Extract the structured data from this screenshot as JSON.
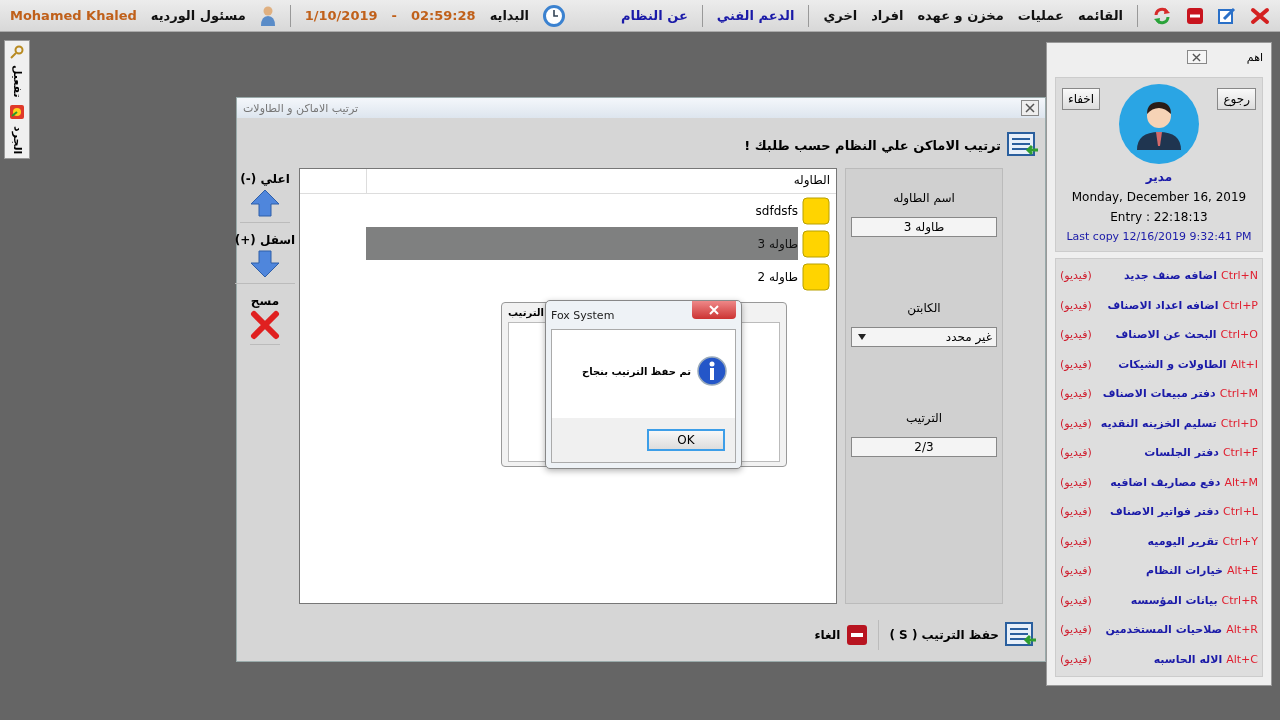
{
  "top_bar": {
    "actions": [
      {
        "kind": "close"
      },
      {
        "kind": "edit"
      },
      {
        "kind": "minimize"
      },
      {
        "kind": "refresh"
      }
    ],
    "menu": [
      {
        "label": "القائمه",
        "kind": "menu"
      },
      {
        "label": "عمليات",
        "kind": "menu"
      },
      {
        "label": "مخزن و عهده",
        "kind": "menu"
      },
      {
        "label": "افراد",
        "kind": "menu"
      },
      {
        "label": "اخري",
        "kind": "menu"
      },
      {
        "label": "الدعم الفني",
        "kind": "link"
      },
      {
        "label": "عن النظام",
        "kind": "link"
      }
    ],
    "start_label": "البدايه",
    "time": "02:59:28",
    "separator": "-",
    "date": "1/10/2019",
    "role": "مسئول الورديه",
    "user_name": "Mohamed Khaled"
  },
  "side_strip": [
    {
      "label": "تفعيل"
    },
    {
      "label": "الجرد"
    }
  ],
  "arrange_window": {
    "title": "ترتيب الاماكن و الطاولات",
    "heading": "ترتيب الاماكن علي النظام حسب طلبك !",
    "move_buttons": [
      {
        "label": "اعلي (-)",
        "kind": "up"
      },
      {
        "label": "اسفل (+)",
        "kind": "down"
      },
      {
        "label": "مسح",
        "kind": "delete"
      }
    ],
    "table": {
      "columns": [
        "الطاوله"
      ],
      "rows": [
        {
          "name": "sdfdsfs",
          "selected": false
        },
        {
          "name": "طاوله 3",
          "selected": true
        },
        {
          "name": "طاوله 2",
          "selected": false
        }
      ]
    },
    "fields": [
      {
        "label": "اسم الطاوله",
        "value": "طاوله 3",
        "kind": "text"
      },
      {
        "label": "الكابتن",
        "value": "غير محدد",
        "kind": "select"
      },
      {
        "label": "الترتيب",
        "value": "2/3",
        "kind": "text"
      }
    ],
    "footer_buttons": [
      {
        "label": "حفظ الترتيب ( S )",
        "kind": "save"
      },
      {
        "label": "الغاء",
        "kind": "cancel"
      }
    ]
  },
  "behind_dialog": {
    "title": "الترتيب"
  },
  "message_box": {
    "title": "Fox System",
    "message": "تم حفظ الترتيب بنجاح",
    "button": "OK"
  },
  "side_panel": {
    "title": "اهم",
    "buttons": [
      {
        "label": "رجوع"
      },
      {
        "label": "اخفاء"
      }
    ],
    "role": "مدير",
    "date": "Monday, December 16, 2019",
    "entry": "Entry : 22:18:13",
    "last_copy": "Last copy 12/16/2019 9:32:41 PM",
    "shortcuts": [
      {
        "keys": "Ctrl+N",
        "label": "اضافه صنف جديد",
        "video": "(فيديو)"
      },
      {
        "keys": "Ctrl+P",
        "label": "اضافه اعداد الاصناف",
        "video": "(فيديو)"
      },
      {
        "keys": "Ctrl+O",
        "label": "البحث عن الاصناف",
        "video": "(فيديو)"
      },
      {
        "keys": "Alt+I",
        "label": "الطاولات و الشيكات",
        "video": "(فيديو)"
      },
      {
        "keys": "Ctrl+M",
        "label": "دفتر مبيعات الاصناف",
        "video": "(فيديو)"
      },
      {
        "keys": "Ctrl+D",
        "label": "تسليم الخزينه النقديه",
        "video": "(فيديو)"
      },
      {
        "keys": "Ctrl+F",
        "label": "دفتر الجلسات",
        "video": "(فيديو)"
      },
      {
        "keys": "Alt+M",
        "label": "دفع مصاريف اضافيه",
        "video": "(فيديو)"
      },
      {
        "keys": "Ctrl+L",
        "label": "دفتر فواتير الاصناف",
        "video": "(فيديو)"
      },
      {
        "keys": "Ctrl+Y",
        "label": "تقرير اليوميه",
        "video": "(فيديو)"
      },
      {
        "keys": "Alt+E",
        "label": "خيارات النظام",
        "video": "(فيديو)"
      },
      {
        "keys": "Ctrl+R",
        "label": "بيانات المؤسسه",
        "video": "(فيديو)"
      },
      {
        "keys": "Alt+R",
        "label": "صلاحيات المستخدمين",
        "video": "(فيديو)"
      },
      {
        "keys": "Alt+C",
        "label": "الاله الحاسبه",
        "video": "(فيديو)"
      }
    ]
  }
}
